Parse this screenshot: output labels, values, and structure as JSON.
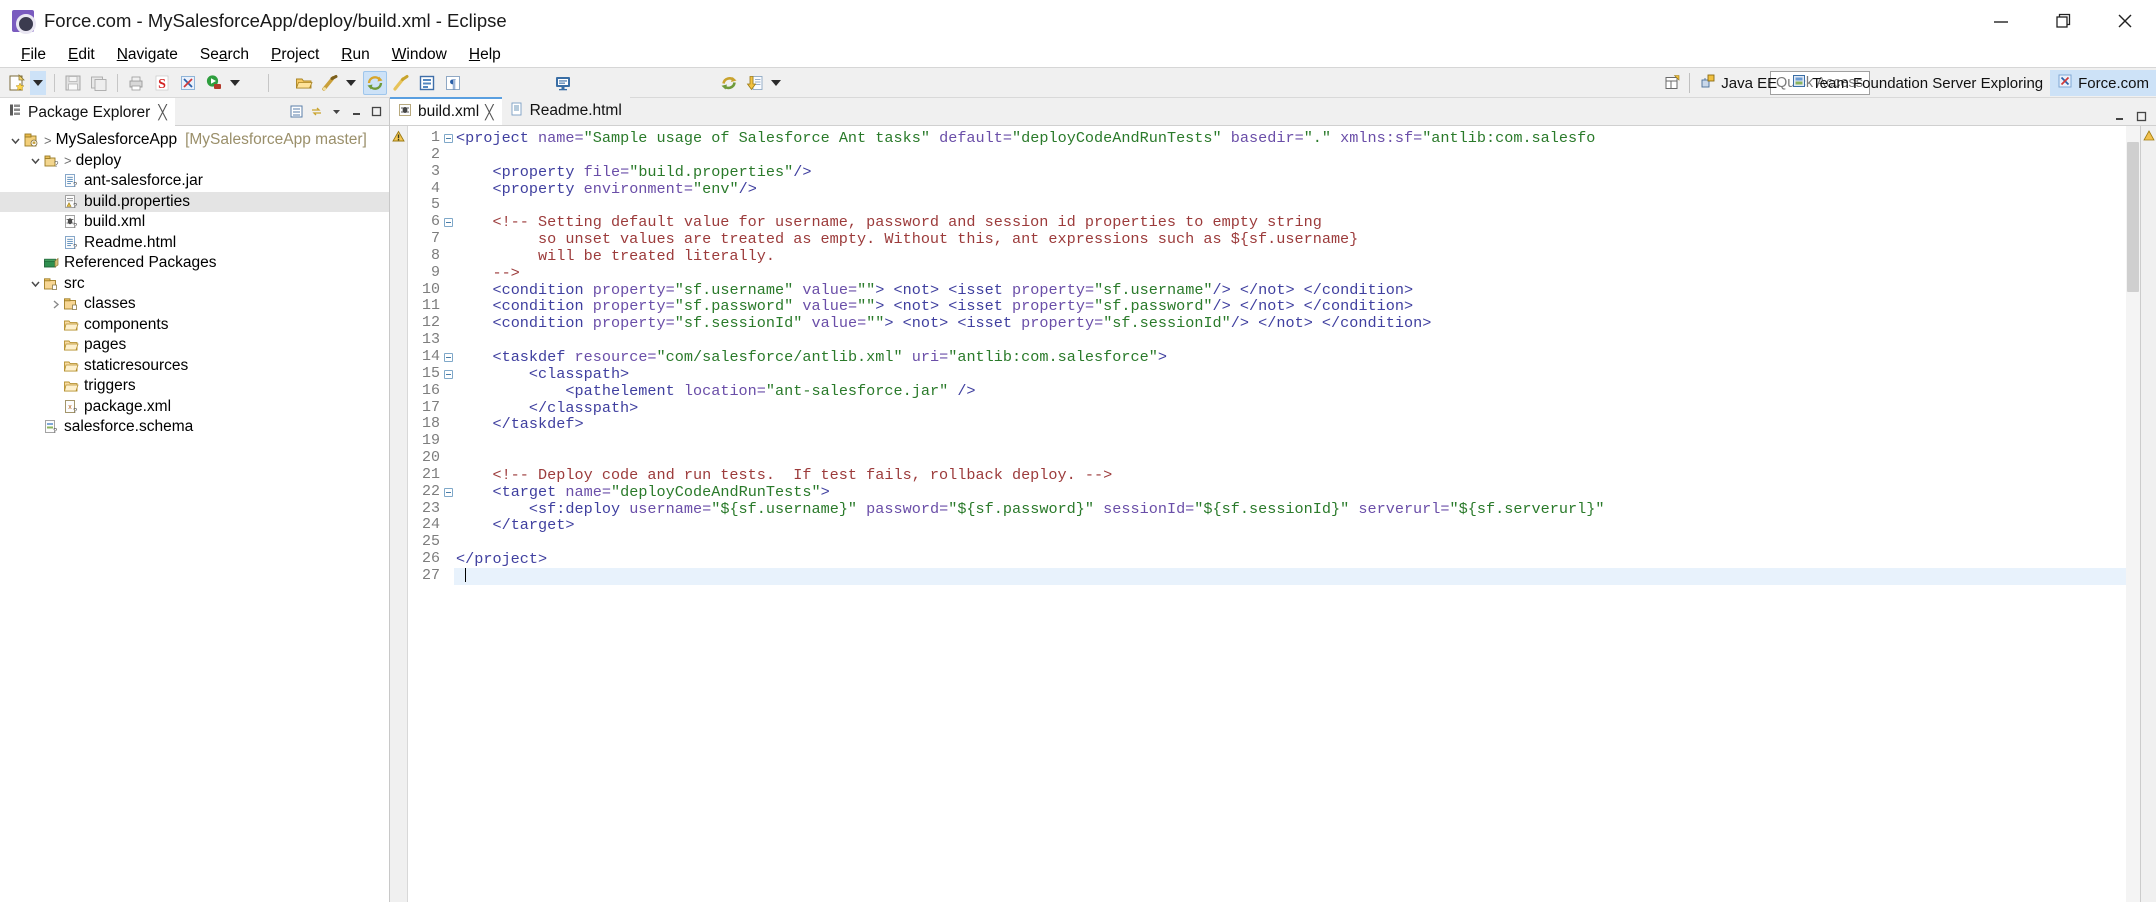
{
  "window": {
    "title": "Force.com - MySalesforceApp/deploy/build.xml - Eclipse",
    "icon": "forcecom-app-icon",
    "minimize": "—",
    "maximize": "❐",
    "close": "✕"
  },
  "menubar": {
    "items": [
      {
        "label": "File",
        "mnemonic": "F"
      },
      {
        "label": "Edit",
        "mnemonic": "E"
      },
      {
        "label": "Navigate",
        "mnemonic": "N"
      },
      {
        "label": "Search",
        "mnemonic": "a"
      },
      {
        "label": "Project",
        "mnemonic": "P"
      },
      {
        "label": "Run",
        "mnemonic": "R"
      },
      {
        "label": "Window",
        "mnemonic": "W"
      },
      {
        "label": "Help",
        "mnemonic": "H"
      }
    ]
  },
  "toolbar": {
    "buttons": [
      {
        "name": "new-wizard",
        "icon": "new-file-icon"
      },
      {
        "name": "new-dropdown",
        "icon": "chevron-down-icon"
      },
      {
        "name": "save",
        "icon": "save-icon"
      },
      {
        "name": "save-all",
        "icon": "save-all-icon"
      },
      {
        "name": "print",
        "icon": "print-icon"
      },
      {
        "name": "salesforce-deploy",
        "icon": "salesforce-s-icon"
      },
      {
        "name": "force-com-tools",
        "icon": "force-x-icon"
      },
      {
        "name": "run",
        "icon": "run-green-icon"
      },
      {
        "name": "run-dropdown",
        "icon": "chevron-down-icon"
      },
      {
        "name": "open-type",
        "icon": "open-folder-icon"
      },
      {
        "name": "external-tools",
        "icon": "external-tools-icon"
      },
      {
        "name": "external-tools-dropdown",
        "icon": "chevron-down-icon"
      },
      {
        "name": "search",
        "icon": "refresh-arrows-icon"
      },
      {
        "name": "quick-fix",
        "icon": "brush-icon"
      },
      {
        "name": "toggle-block-selection",
        "icon": "block-selection-icon"
      },
      {
        "name": "show-whitespace",
        "icon": "pilcrow-icon"
      },
      {
        "name": "console",
        "icon": "console-monitor-icon"
      },
      {
        "name": "refresh-project",
        "icon": "refresh-project-icon"
      },
      {
        "name": "retrieve-code",
        "icon": "download-doc-icon"
      },
      {
        "name": "retrieve-dropdown",
        "icon": "chevron-down-icon"
      }
    ],
    "quick_access_placeholder": "Quick Access"
  },
  "perspectives": {
    "open_button_icon": "open-perspective-icon",
    "tabs": [
      {
        "label": "Java EE",
        "icon": "java-ee-icon",
        "active": false
      },
      {
        "label": "Team Foundation Server Exploring",
        "icon": "tfs-icon",
        "active": false
      },
      {
        "label": "Force.com",
        "icon": "force-x-icon",
        "active": true
      }
    ]
  },
  "explorer": {
    "tab_label": "Package Explorer",
    "tab_icon": "package-explorer-icon",
    "tab_close": "╳",
    "tools": [
      {
        "name": "collapse-all",
        "icon": "collapse-all-icon"
      },
      {
        "name": "link-with-editor",
        "icon": "link-editor-icon"
      },
      {
        "name": "view-menu",
        "icon": "view-menu-icon"
      },
      {
        "name": "minimize-view",
        "icon": "minimize-icon"
      },
      {
        "name": "maximize-view",
        "icon": "maximize-icon"
      }
    ],
    "tree": [
      {
        "label": "MySalesforceApp",
        "sub": "[MySalesforceApp master]",
        "depth": 0,
        "twist": "open",
        "gt": true,
        "icon": "project-icon",
        "selected": false
      },
      {
        "label": "deploy",
        "sub": "",
        "depth": 1,
        "twist": "open",
        "gt": true,
        "icon": "package-icon",
        "selected": false
      },
      {
        "label": "ant-salesforce.jar",
        "sub": "",
        "depth": 2,
        "twist": "none",
        "gt": false,
        "icon": "file-doc-icon",
        "selected": false
      },
      {
        "label": "build.properties",
        "sub": "",
        "depth": 2,
        "twist": "none",
        "gt": false,
        "icon": "properties-file-icon",
        "selected": true
      },
      {
        "label": "build.xml",
        "sub": "",
        "depth": 2,
        "twist": "none",
        "gt": false,
        "icon": "ant-file-icon",
        "selected": false
      },
      {
        "label": "Readme.html",
        "sub": "",
        "depth": 2,
        "twist": "none",
        "gt": false,
        "icon": "html-file-icon",
        "selected": false
      },
      {
        "label": "Referenced Packages",
        "sub": "",
        "depth": 1,
        "twist": "none",
        "gt": false,
        "icon": "library-icon",
        "selected": false
      },
      {
        "label": "src",
        "sub": "",
        "depth": 1,
        "twist": "open",
        "gt": false,
        "icon": "source-folder-icon",
        "selected": false
      },
      {
        "label": "classes",
        "sub": "",
        "depth": 2,
        "twist": "closed",
        "gt": false,
        "icon": "source-folder-icon",
        "selected": false
      },
      {
        "label": "components",
        "sub": "",
        "depth": 2,
        "twist": "none",
        "gt": false,
        "icon": "folder-icon",
        "selected": false
      },
      {
        "label": "pages",
        "sub": "",
        "depth": 2,
        "twist": "none",
        "gt": false,
        "icon": "folder-icon",
        "selected": false
      },
      {
        "label": "staticresources",
        "sub": "",
        "depth": 2,
        "twist": "none",
        "gt": false,
        "icon": "folder-icon",
        "selected": false
      },
      {
        "label": "triggers",
        "sub": "",
        "depth": 2,
        "twist": "none",
        "gt": false,
        "icon": "folder-icon",
        "selected": false
      },
      {
        "label": "package.xml",
        "sub": "",
        "depth": 2,
        "twist": "none",
        "gt": false,
        "icon": "xml-file-icon",
        "selected": false
      },
      {
        "label": "salesforce.schema",
        "sub": "",
        "depth": 1,
        "twist": "none",
        "gt": false,
        "icon": "schema-file-icon",
        "selected": false
      }
    ]
  },
  "editor": {
    "tabs": [
      {
        "label": "build.xml",
        "icon": "ant-file-icon",
        "active": true,
        "close": "╳"
      },
      {
        "label": "Readme.html",
        "icon": "html-file-icon",
        "active": false,
        "close": ""
      }
    ],
    "tools": [
      {
        "name": "minimize-editor",
        "icon": "minimize-icon"
      },
      {
        "name": "maximize-editor",
        "icon": "maximize-icon"
      }
    ],
    "cursor_line": 27,
    "line_count": 27,
    "warning_marker_line": 1,
    "lines": [
      {
        "n": 1,
        "fold": "open",
        "marker": "warning",
        "tokens": [
          {
            "t": "tag",
            "s": "<project"
          },
          {
            "t": "plain",
            "s": " "
          },
          {
            "t": "attr",
            "s": "name="
          },
          {
            "t": "val",
            "s": "\"Sample usage of Salesforce Ant tasks\""
          },
          {
            "t": "plain",
            "s": " "
          },
          {
            "t": "attr",
            "s": "default="
          },
          {
            "t": "val",
            "s": "\"deployCodeAndRunTests\""
          },
          {
            "t": "plain",
            "s": " "
          },
          {
            "t": "attr",
            "s": "basedir="
          },
          {
            "t": "val",
            "s": "\".\""
          },
          {
            "t": "plain",
            "s": " "
          },
          {
            "t": "attr",
            "s": "xmlns:sf="
          },
          {
            "t": "val",
            "s": "\"antlib:com.salesfo"
          }
        ]
      },
      {
        "n": 2,
        "fold": "",
        "marker": "",
        "tokens": []
      },
      {
        "n": 3,
        "fold": "",
        "marker": "",
        "tokens": [
          {
            "t": "plain",
            "s": "    "
          },
          {
            "t": "tag",
            "s": "<property"
          },
          {
            "t": "plain",
            "s": " "
          },
          {
            "t": "attr",
            "s": "file="
          },
          {
            "t": "val",
            "s": "\"build.properties\""
          },
          {
            "t": "tag",
            "s": "/>"
          }
        ]
      },
      {
        "n": 4,
        "fold": "",
        "marker": "",
        "tokens": [
          {
            "t": "plain",
            "s": "    "
          },
          {
            "t": "tag",
            "s": "<property"
          },
          {
            "t": "plain",
            "s": " "
          },
          {
            "t": "attr",
            "s": "environment="
          },
          {
            "t": "val",
            "s": "\"env\""
          },
          {
            "t": "tag",
            "s": "/>"
          }
        ]
      },
      {
        "n": 5,
        "fold": "",
        "marker": "",
        "tokens": []
      },
      {
        "n": 6,
        "fold": "open",
        "marker": "",
        "tokens": [
          {
            "t": "cmt",
            "s": "    <!-- Setting default value for username, password and session id properties to empty string"
          }
        ]
      },
      {
        "n": 7,
        "fold": "",
        "marker": "",
        "tokens": [
          {
            "t": "cmt",
            "s": "         so unset values are treated as empty. Without this, ant expressions such as ${sf.username}"
          }
        ]
      },
      {
        "n": 8,
        "fold": "",
        "marker": "",
        "tokens": [
          {
            "t": "cmt",
            "s": "         will be treated literally."
          }
        ]
      },
      {
        "n": 9,
        "fold": "",
        "marker": "",
        "tokens": [
          {
            "t": "cmt",
            "s": "    -->"
          }
        ]
      },
      {
        "n": 10,
        "fold": "",
        "marker": "",
        "tokens": [
          {
            "t": "plain",
            "s": "    "
          },
          {
            "t": "tag",
            "s": "<condition"
          },
          {
            "t": "plain",
            "s": " "
          },
          {
            "t": "attr",
            "s": "property="
          },
          {
            "t": "val",
            "s": "\"sf.username\""
          },
          {
            "t": "plain",
            "s": " "
          },
          {
            "t": "attr",
            "s": "value="
          },
          {
            "t": "val",
            "s": "\"\""
          },
          {
            "t": "tag",
            "s": "> <not> <isset"
          },
          {
            "t": "plain",
            "s": " "
          },
          {
            "t": "attr",
            "s": "property="
          },
          {
            "t": "val",
            "s": "\"sf.username\""
          },
          {
            "t": "tag",
            "s": "/> </not> </condition>"
          }
        ]
      },
      {
        "n": 11,
        "fold": "",
        "marker": "",
        "tokens": [
          {
            "t": "plain",
            "s": "    "
          },
          {
            "t": "tag",
            "s": "<condition"
          },
          {
            "t": "plain",
            "s": " "
          },
          {
            "t": "attr",
            "s": "property="
          },
          {
            "t": "val",
            "s": "\"sf.password\""
          },
          {
            "t": "plain",
            "s": " "
          },
          {
            "t": "attr",
            "s": "value="
          },
          {
            "t": "val",
            "s": "\"\""
          },
          {
            "t": "tag",
            "s": "> <not> <isset"
          },
          {
            "t": "plain",
            "s": " "
          },
          {
            "t": "attr",
            "s": "property="
          },
          {
            "t": "val",
            "s": "\"sf.password\""
          },
          {
            "t": "tag",
            "s": "/> </not> </condition>"
          }
        ]
      },
      {
        "n": 12,
        "fold": "",
        "marker": "",
        "tokens": [
          {
            "t": "plain",
            "s": "    "
          },
          {
            "t": "tag",
            "s": "<condition"
          },
          {
            "t": "plain",
            "s": " "
          },
          {
            "t": "attr",
            "s": "property="
          },
          {
            "t": "val",
            "s": "\"sf.sessionId\""
          },
          {
            "t": "plain",
            "s": " "
          },
          {
            "t": "attr",
            "s": "value="
          },
          {
            "t": "val",
            "s": "\"\""
          },
          {
            "t": "tag",
            "s": "> <not> <isset"
          },
          {
            "t": "plain",
            "s": " "
          },
          {
            "t": "attr",
            "s": "property="
          },
          {
            "t": "val",
            "s": "\"sf.sessionId\""
          },
          {
            "t": "tag",
            "s": "/> </not> </condition>"
          }
        ]
      },
      {
        "n": 13,
        "fold": "",
        "marker": "",
        "tokens": []
      },
      {
        "n": 14,
        "fold": "open",
        "marker": "",
        "tokens": [
          {
            "t": "plain",
            "s": "    "
          },
          {
            "t": "tag",
            "s": "<taskdef"
          },
          {
            "t": "plain",
            "s": " "
          },
          {
            "t": "attr",
            "s": "resource="
          },
          {
            "t": "val",
            "s": "\"com/salesforce/antlib.xml\""
          },
          {
            "t": "plain",
            "s": " "
          },
          {
            "t": "attr",
            "s": "uri="
          },
          {
            "t": "val",
            "s": "\"antlib:com.salesforce\""
          },
          {
            "t": "tag",
            "s": ">"
          }
        ]
      },
      {
        "n": 15,
        "fold": "open",
        "marker": "",
        "tokens": [
          {
            "t": "plain",
            "s": "        "
          },
          {
            "t": "tag",
            "s": "<classpath>"
          }
        ]
      },
      {
        "n": 16,
        "fold": "",
        "marker": "",
        "tokens": [
          {
            "t": "plain",
            "s": "            "
          },
          {
            "t": "tag",
            "s": "<pathelement"
          },
          {
            "t": "plain",
            "s": " "
          },
          {
            "t": "attr",
            "s": "location="
          },
          {
            "t": "val",
            "s": "\"ant-salesforce.jar\""
          },
          {
            "t": "plain",
            "s": " "
          },
          {
            "t": "tag",
            "s": "/>"
          }
        ]
      },
      {
        "n": 17,
        "fold": "",
        "marker": "",
        "tokens": [
          {
            "t": "plain",
            "s": "        "
          },
          {
            "t": "tag",
            "s": "</classpath>"
          }
        ]
      },
      {
        "n": 18,
        "fold": "",
        "marker": "",
        "tokens": [
          {
            "t": "plain",
            "s": "    "
          },
          {
            "t": "tag",
            "s": "</taskdef>"
          }
        ]
      },
      {
        "n": 19,
        "fold": "",
        "marker": "",
        "tokens": []
      },
      {
        "n": 20,
        "fold": "",
        "marker": "",
        "tokens": []
      },
      {
        "n": 21,
        "fold": "",
        "marker": "",
        "tokens": [
          {
            "t": "cmt",
            "s": "    <!-- Deploy code and run tests.  If test fails, rollback deploy. -->"
          }
        ]
      },
      {
        "n": 22,
        "fold": "open",
        "marker": "",
        "tokens": [
          {
            "t": "plain",
            "s": "    "
          },
          {
            "t": "tag",
            "s": "<target"
          },
          {
            "t": "plain",
            "s": " "
          },
          {
            "t": "attr",
            "s": "name="
          },
          {
            "t": "val",
            "s": "\"deployCodeAndRunTests\""
          },
          {
            "t": "tag",
            "s": ">"
          }
        ]
      },
      {
        "n": 23,
        "fold": "",
        "marker": "",
        "tokens": [
          {
            "t": "plain",
            "s": "        "
          },
          {
            "t": "tag",
            "s": "<sf:deploy"
          },
          {
            "t": "plain",
            "s": " "
          },
          {
            "t": "attr",
            "s": "username="
          },
          {
            "t": "val",
            "s": "\"${sf.username}\""
          },
          {
            "t": "plain",
            "s": " "
          },
          {
            "t": "attr",
            "s": "password="
          },
          {
            "t": "val",
            "s": "\"${sf.password}\""
          },
          {
            "t": "plain",
            "s": " "
          },
          {
            "t": "attr",
            "s": "sessionId="
          },
          {
            "t": "val",
            "s": "\"${sf.sessionId}\""
          },
          {
            "t": "plain",
            "s": " "
          },
          {
            "t": "attr",
            "s": "serverurl="
          },
          {
            "t": "val",
            "s": "\"${sf.serverurl}\""
          },
          {
            "t": "plain",
            "s": " "
          }
        ]
      },
      {
        "n": 24,
        "fold": "",
        "marker": "",
        "tokens": [
          {
            "t": "plain",
            "s": "    "
          },
          {
            "t": "tag",
            "s": "</target>"
          }
        ]
      },
      {
        "n": 25,
        "fold": "",
        "marker": "",
        "tokens": []
      },
      {
        "n": 26,
        "fold": "",
        "marker": "",
        "tokens": [
          {
            "t": "tag",
            "s": "</project>"
          }
        ]
      },
      {
        "n": 27,
        "fold": "",
        "marker": "",
        "tokens": []
      }
    ]
  },
  "colors": {
    "tag": "#3f3f9f",
    "attribute": "#6a4ea8",
    "value": "#2a7a2a",
    "comment": "#9c3b3b",
    "selection": "#cde2f7",
    "current_line": "#e8f2fc"
  }
}
